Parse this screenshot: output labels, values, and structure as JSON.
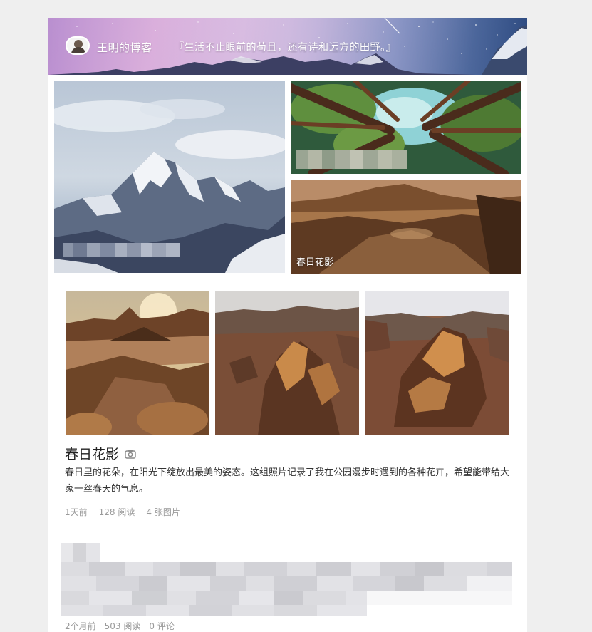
{
  "header": {
    "blog_name": "王明的博客",
    "motto": "『生活不止眼前的苟且，还有诗和远方的田野。』"
  },
  "mosaic": {
    "tiles": [
      {
        "name": "mountain-tile",
        "caption": ""
      },
      {
        "name": "forest-tile",
        "caption": ""
      },
      {
        "name": "desert-tile",
        "caption": "春日花影"
      }
    ]
  },
  "post": {
    "title": "春日花影",
    "description": "春日里的花朵，在阳光下绽放出最美的姿态。这组照片记录了我在公园漫步时遇到的各种花卉，希望能带给大家一丝春天的气息。",
    "time": "1天前",
    "reads": "128 阅读",
    "photos": "4 张图片",
    "icon": "camera-icon"
  },
  "post2": {
    "time": "2个月前",
    "reads": "503 阅读",
    "comments": "0 评论"
  }
}
